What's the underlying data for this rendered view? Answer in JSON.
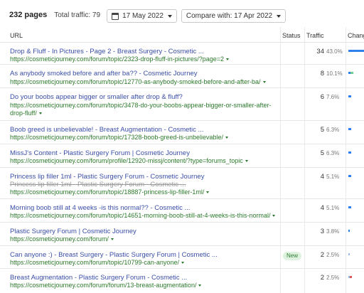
{
  "toolbar": {
    "pages_count": "232 pages",
    "total_traffic": "Total traffic: 79",
    "date": "17 May 2022",
    "compare": "Compare with: 17 Apr 2022"
  },
  "columns": {
    "url": "URL",
    "status": "Status",
    "traffic": "Traffic",
    "change": "Chang"
  },
  "colors": {
    "bar_blue": "#2f80ed",
    "bar_red": "#e05656",
    "bar_light": "#9db9e6",
    "link_title": "#3a4ea8",
    "link_url": "#2c7a2c",
    "badge_bg": "#dff2df"
  },
  "rows": [
    {
      "title": "Drop & Fluff - In Pictures - Page 2 - Breast Surgery - Cosmetic ...",
      "url": "https://cosmeticjourney.com/forum/topic/2323-drop-fluff-in-pictures/?page=2",
      "traffic": "34",
      "share": "43.0%"
    },
    {
      "title": "As anybody smoked before and after ba?? - Cosmetic Journey",
      "url": "https://cosmeticjourney.com/forum/topic/12770-as-anybody-smoked-before-and-after-ba/",
      "traffic": "8",
      "share": "10.1%"
    },
    {
      "title": "Do your boobs appear bigger or smaller after drop & fluff?",
      "url": "https://cosmeticjourney.com/forum/topic/3478-do-your-boobs-appear-bigger-or-smaller-after-drop-fluff/",
      "traffic": "6",
      "share": "7.6%"
    },
    {
      "title": "Boob greed is unbelievable! - Breast Augmentation - Cosmetic ...",
      "url": "https://cosmeticjourney.com/forum/topic/17328-boob-greed-is-unbelievable/",
      "traffic": "5",
      "share": "6.3%"
    },
    {
      "title": "MissJ's Content - Plastic Surgery Forum | Cosmetic Journey",
      "url": "https://cosmeticjourney.com/forum/profile/12920-missj/content/?type=forums_topic",
      "traffic": "5",
      "share": "6.3%"
    },
    {
      "title": "Princess lip filler 1ml - Plastic Surgery Forum - Cosmetic Journey",
      "old_title": "Princess lip filler 1ml - Plastic Surgery Forum - Cosmetic ...",
      "url": "https://cosmeticjourney.com/forum/topic/18887-princess-lip-filler-1ml/",
      "traffic": "4",
      "share": "5.1%"
    },
    {
      "title": "Morning boob still at 4 weeks -is this normal?? - Cosmetic ...",
      "url": "https://cosmeticjourney.com/forum/topic/14651-morning-boob-still-at-4-weeks-is-this-normal/",
      "traffic": "4",
      "share": "5.1%"
    },
    {
      "title": "Plastic Surgery Forum | Cosmetic Journey",
      "url": "https://cosmeticjourney.com/forum/",
      "traffic": "3",
      "share": "3.8%"
    },
    {
      "title": "Can anyone :) - Breast Surgery - Plastic Surgery Forum | Cosmetic ...",
      "url": "https://cosmeticjourney.com/forum/topic/10799-can-anyone/",
      "status": "New",
      "traffic": "2",
      "share": "2.5%"
    },
    {
      "title": "Breast Augmentation - Plastic Surgery Forum - Cosmetic ...",
      "url": "https://cosmeticjourney.com/forum/forum/13-breast-augmentation/",
      "traffic": "2",
      "share": "2.5%"
    }
  ]
}
